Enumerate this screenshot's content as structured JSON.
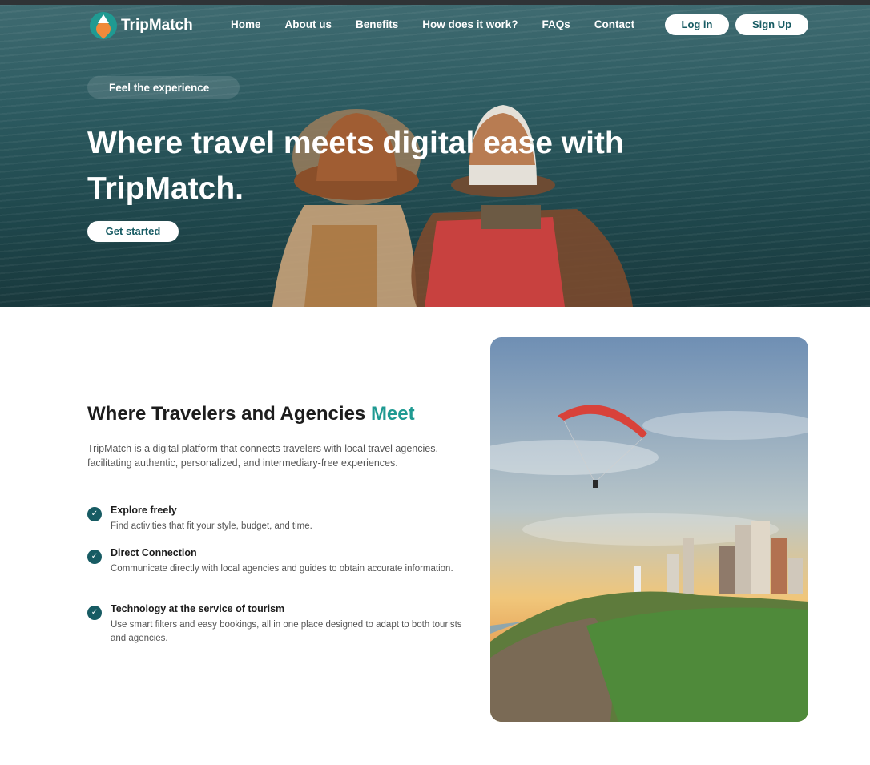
{
  "brand": {
    "name": "TripMatch",
    "accent": "#1f9a92",
    "dark": "#175b63"
  },
  "nav": {
    "items": [
      "Home",
      "About us",
      "Benefits",
      "How does it work?",
      "FAQs",
      "Contact"
    ],
    "login_label": "Log in",
    "signup_label": "Sign Up"
  },
  "hero": {
    "tagline": "Feel the experience",
    "title": "Where travel meets digital ease with TripMatch.",
    "cta_label": "Get started"
  },
  "about": {
    "title_main": "Where Travelers and Agencies ",
    "title_accent": "Meet",
    "intro": "TripMatch is a digital platform that connects travelers with local travel agencies, facilitating authentic, personalized, and intermediary-free experiences.",
    "features": [
      {
        "title": "Explore freely",
        "desc": "Find activities that fit your style, budget, and time."
      },
      {
        "title": "Direct Connection",
        "desc": "Communicate directly with local agencies and guides to obtain accurate information."
      },
      {
        "title": "Technology at the service of tourism",
        "desc": "Use smart filters and easy bookings, all in one place designed to adapt to both tourists and agencies."
      }
    ],
    "check_icon": "check-circle-icon"
  }
}
